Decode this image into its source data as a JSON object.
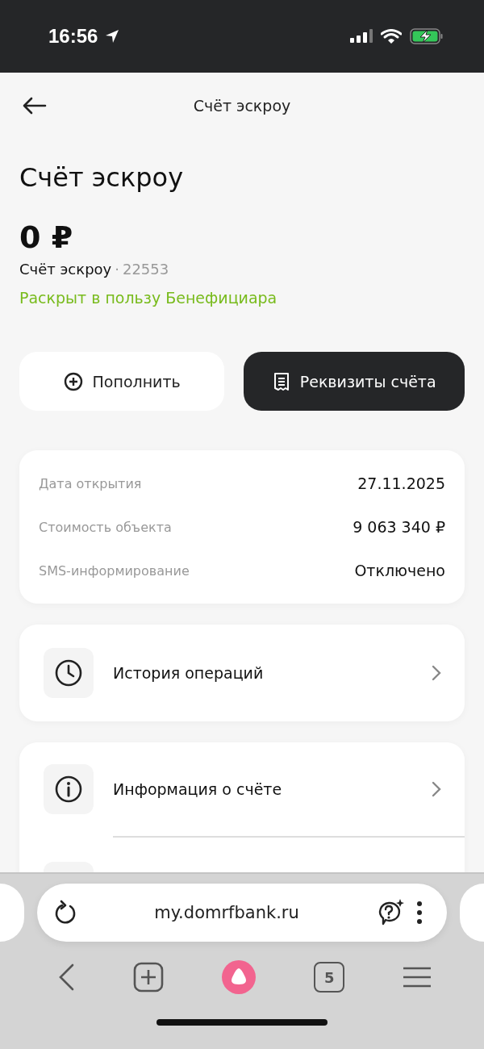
{
  "status_bar": {
    "time": "16:56"
  },
  "header": {
    "title": "Счёт эскроу"
  },
  "account": {
    "title": "Счёт эскроу",
    "balance": "0 ₽",
    "name": "Счёт эскроу",
    "separator": "·",
    "number": "22553",
    "status": "Раскрыт в пользу Бенефициара"
  },
  "actions": [
    {
      "label": "Пополнить",
      "kind": "topup"
    },
    {
      "label": "Реквизиты счёта",
      "kind": "details"
    }
  ],
  "details": [
    {
      "label": "Дата открытия",
      "value": "27.11.2025"
    },
    {
      "label": "Стоимость объекта",
      "value": "9 063 340 ₽"
    },
    {
      "label": "SMS-информирование",
      "value": "Отключено"
    }
  ],
  "menu": [
    {
      "label": "История операций",
      "kind": "history"
    }
  ],
  "menu_group": [
    {
      "label": "Информация о счёте",
      "kind": "info"
    }
  ],
  "browser": {
    "url": "my.domrfbank.ru",
    "tabs_count": "5"
  }
}
